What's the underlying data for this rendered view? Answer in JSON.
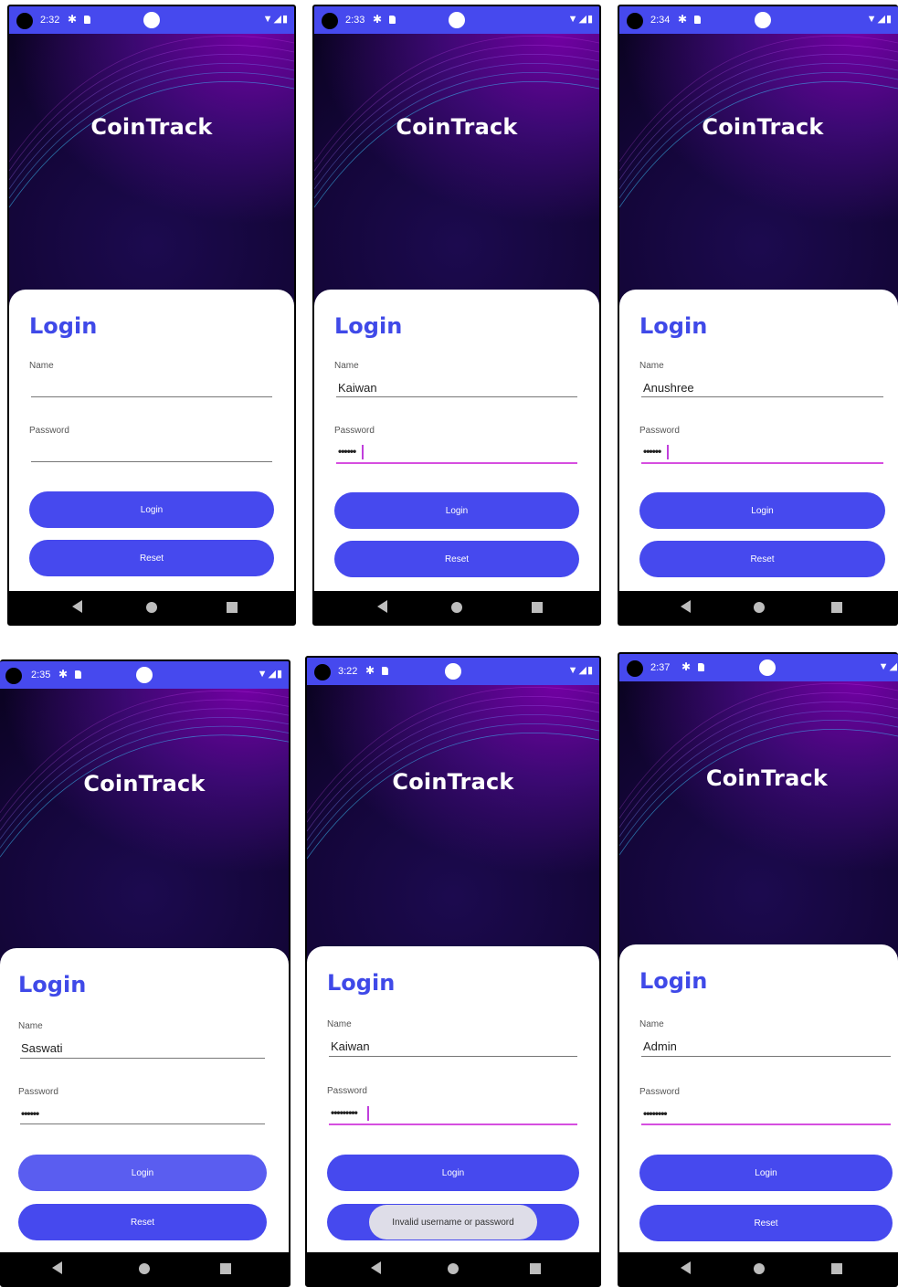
{
  "app_name": "CoinTrack",
  "screens": [
    {
      "time": "2:32",
      "title": "Login",
      "name_label": "Name",
      "name_value": "",
      "password_label": "Password",
      "password_value": "",
      "login_label": "Login",
      "reset_label": "Reset"
    },
    {
      "time": "2:33",
      "title": "Login",
      "name_label": "Name",
      "name_value": "Kaiwan",
      "password_label": "Password",
      "password_value": "••••••",
      "login_label": "Login",
      "reset_label": "Reset"
    },
    {
      "time": "2:34",
      "title": "Login",
      "name_label": "Name",
      "name_value": "Anushree",
      "password_label": "Password",
      "password_value": "••••••",
      "login_label": "Login",
      "reset_label": "Reset"
    },
    {
      "time": "2:35",
      "title": "Login",
      "name_label": "Name",
      "name_value": "Saswati",
      "password_label": "Password",
      "password_value": "••••••",
      "login_label": "Login",
      "reset_label": "Reset"
    },
    {
      "time": "3:22",
      "title": "Login",
      "name_label": "Name",
      "name_value": "Kaiwan",
      "password_label": "Password",
      "password_value": "•••••••••",
      "login_label": "Login",
      "reset_label": "Reset",
      "toast": "Invalid username or password"
    },
    {
      "time": "2:37",
      "title": "Login",
      "name_label": "Name",
      "name_value": "Admin",
      "password_label": "Password",
      "password_value": "••••••••",
      "login_label": "Login",
      "reset_label": "Reset"
    }
  ],
  "icons": {
    "settings": "gear-icon",
    "sd": "sd-card-icon",
    "wifi": "wifi-icon",
    "signal": "signal-icon",
    "battery": "battery-icon",
    "back": "back-icon",
    "home": "home-icon",
    "recents": "recents-icon"
  },
  "colors": {
    "accent": "#4649EE",
    "focus_underline": "#d64ee0"
  }
}
